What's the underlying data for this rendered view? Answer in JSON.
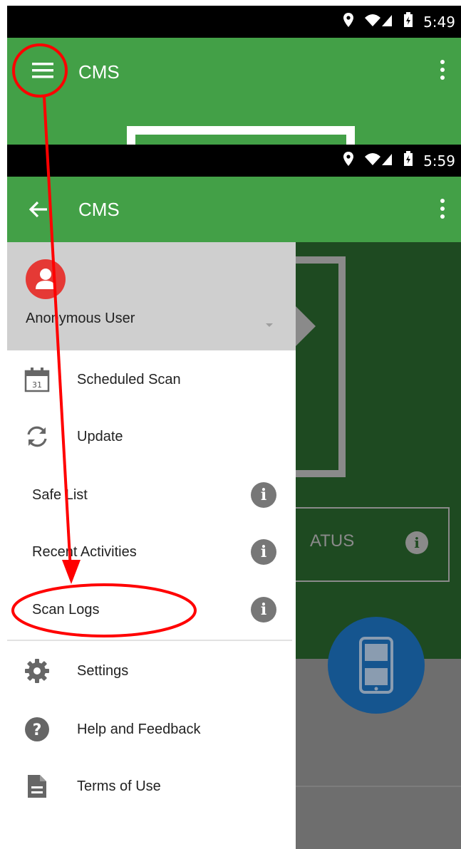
{
  "top_screen": {
    "status": {
      "time": "5:49"
    },
    "app_title": "CMS"
  },
  "main_screen": {
    "status": {
      "time": "5:59"
    },
    "app_title": "CMS",
    "background": {
      "status_text": "ATUS"
    },
    "drawer": {
      "user_name": "Anonymous User",
      "items": [
        {
          "label": "Scheduled Scan",
          "icon": "calendar-icon",
          "calendar_day": "31"
        },
        {
          "label": "Update",
          "icon": "sync-icon"
        },
        {
          "label": "Safe List",
          "info": true
        },
        {
          "label": "Recent Activities",
          "info": true
        },
        {
          "label": "Scan Logs",
          "info": true
        }
      ],
      "footer_items": [
        {
          "label": "Settings",
          "icon": "gear-icon"
        },
        {
          "label": "Help and Feedback",
          "icon": "help-icon"
        },
        {
          "label": "Terms of Use",
          "icon": "document-icon"
        }
      ]
    }
  },
  "colors": {
    "appbar": "#43a047",
    "annotation": "#ff0000",
    "avatar": "#e53935",
    "fab": "#1565c0"
  }
}
